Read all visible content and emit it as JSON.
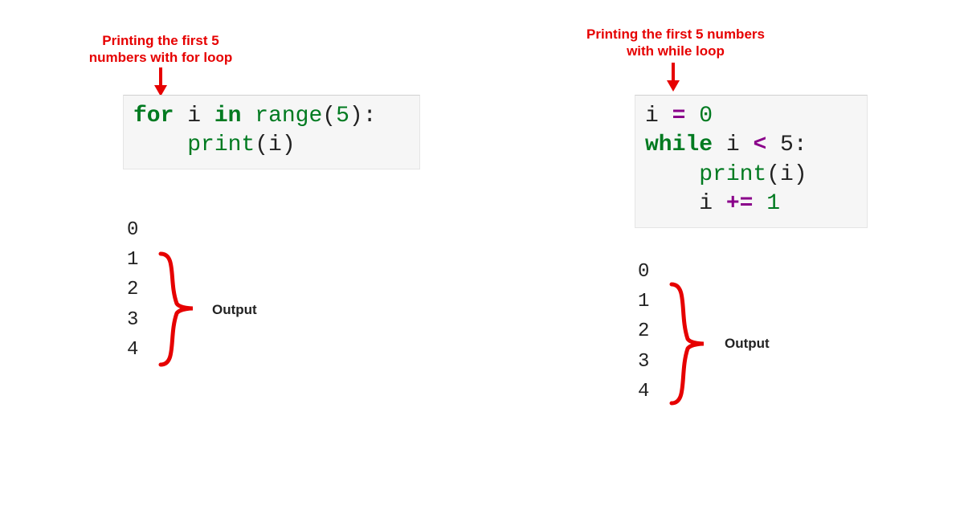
{
  "left": {
    "annotation": "Printing the first 5\nnumbers with for loop",
    "code": {
      "line1": {
        "kw1": "for",
        "sp1": " i ",
        "kw2": "in",
        "sp2": " ",
        "fn": "range",
        "paren_open": "(",
        "num": "5",
        "paren_close": "):"
      },
      "line2": {
        "indent": "    ",
        "fn": "print",
        "paren_open": "(",
        "arg": "i",
        "paren_close": ")"
      }
    },
    "output": "0\n1\n2\n3\n4",
    "output_label": "Output"
  },
  "right": {
    "annotation": "Printing the first 5\nnumbers with while loop",
    "code": {
      "line1": {
        "var": "i ",
        "op": "=",
        "sp": " ",
        "num": "0"
      },
      "line2": {
        "kw": "while",
        "sp": " i ",
        "op": "<",
        "sp2": " 5:"
      },
      "line3": {
        "indent": "    ",
        "fn": "print",
        "paren_open": "(",
        "arg": "i",
        "paren_close": ")"
      },
      "line4": {
        "indent": "    ",
        "var": "i ",
        "op": "+=",
        "sp": " ",
        "num": "1"
      }
    },
    "output": "0\n1\n2\n3\n4",
    "output_label": "Output"
  },
  "colors": {
    "annotation_red": "#e60000",
    "keyword_green": "#007a20",
    "operator_purple": "#8a008a",
    "code_bg": "#f6f6f6"
  }
}
